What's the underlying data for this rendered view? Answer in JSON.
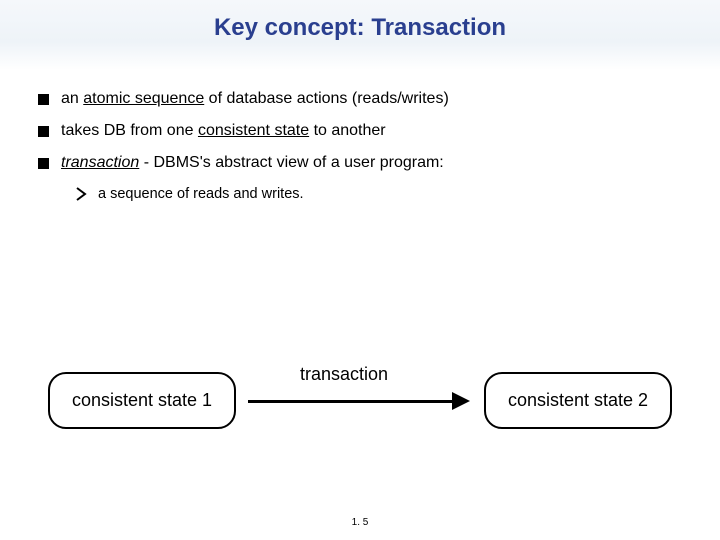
{
  "title": "Key concept: Transaction",
  "bullets": {
    "b1_pre": "an ",
    "b1_u": "atomic sequence",
    "b1_post": " of database actions (reads/writes)",
    "b2_pre": "takes DB from one ",
    "b2_u": "consistent state",
    "b2_post": " to another",
    "b3_term": "transaction",
    "b3_rest": " - DBMS's abstract view of a user program:",
    "sub1": "a sequence of reads and writes."
  },
  "diagram": {
    "state1": "consistent state 1",
    "state2": "consistent state 2",
    "arrow_label": "transaction"
  },
  "footer": "1. 5"
}
